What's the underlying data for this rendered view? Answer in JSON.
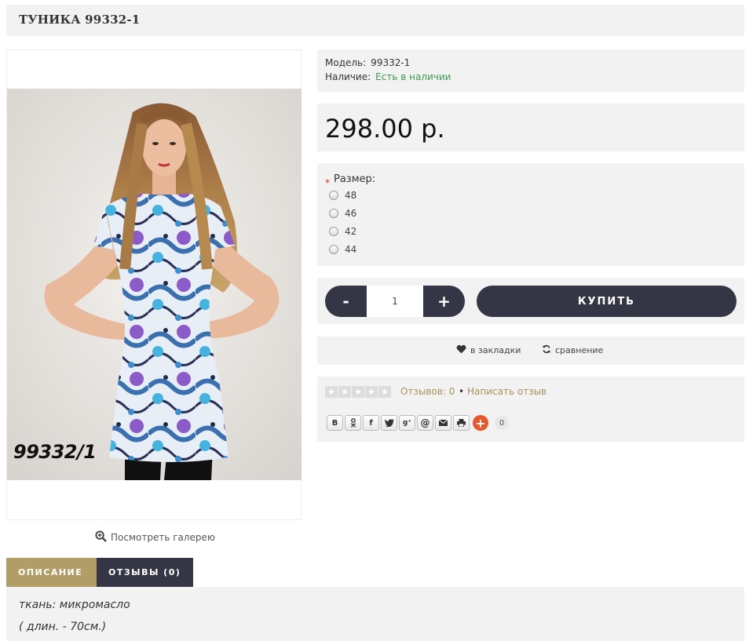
{
  "product": {
    "title": "ТУНИКА 99332-1",
    "photo_label": "99332/1",
    "gallery_link": "Посмотреть галерею"
  },
  "info": {
    "model_label": "Модель:",
    "model_value": "99332-1",
    "stock_label": "Наличие:",
    "stock_value": "Есть в наличии"
  },
  "price": "298.00 р.",
  "options": {
    "required_mark": "*",
    "label": "Размер:",
    "sizes": [
      "48",
      "46",
      "42",
      "44"
    ]
  },
  "buy": {
    "minus": "-",
    "quantity": "1",
    "plus": "+",
    "button": "КУПИТЬ"
  },
  "actions": {
    "wishlist": "в закладки",
    "compare": "сравнение"
  },
  "reviews": {
    "rating_stars": 0,
    "count_text": "Отзывов: 0",
    "separator": "•",
    "write_text": "Написать отзыв"
  },
  "share": {
    "buttons": [
      "vk-icon",
      "odnoklassniki-icon",
      "facebook-icon",
      "twitter-icon",
      "googleplus-icon",
      "mailru-icon",
      "email-icon",
      "print-icon"
    ],
    "count": "0"
  },
  "tabs": [
    {
      "label": "ОПИСАНИЕ",
      "active": true
    },
    {
      "label": "ОТЗЫВЫ (0)",
      "active": false
    }
  ],
  "description": {
    "line1": "ткань: микромасло",
    "line2": "( длин. - 70см.)"
  },
  "colors": {
    "dark": "#343645",
    "gold": "#b19e67",
    "green": "#3a9a4e",
    "panel": "#f2f2f2",
    "share_plus": "#e8562a"
  }
}
